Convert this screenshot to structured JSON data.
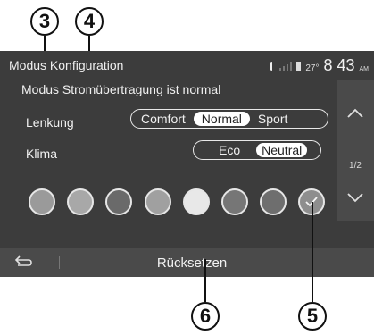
{
  "callouts": {
    "c3": "3",
    "c4": "4",
    "c5": "5",
    "c6": "6"
  },
  "header": {
    "title": "Modus Konfiguration",
    "temperature": "27°",
    "clock": "8 43",
    "ampm": "AM"
  },
  "subtitle": "Modus Stromübertragung ist normal",
  "steering": {
    "label": "Lenkung",
    "options": [
      "Comfort",
      "Normal",
      "Sport"
    ],
    "selected": "Normal"
  },
  "climate": {
    "label": "Klima",
    "options": [
      "Eco",
      "Neutral"
    ],
    "selected": "Neutral"
  },
  "ambient_colors": {
    "swatches": [
      "#9a9a9a",
      "#a8a8a8",
      "#6a6a6a",
      "#a0a0a0",
      "#e8e8e8",
      "#767676",
      "#6e6e6e",
      "#8e8e8e"
    ],
    "selected_index": 7
  },
  "pager": {
    "text": "1/2"
  },
  "icons": {
    "up": "chevron-up-icon",
    "down": "chevron-down-icon",
    "back": "back-arrow-icon",
    "check": "checkmark-icon"
  },
  "footer": {
    "reset_label": "Rücksetzen"
  }
}
